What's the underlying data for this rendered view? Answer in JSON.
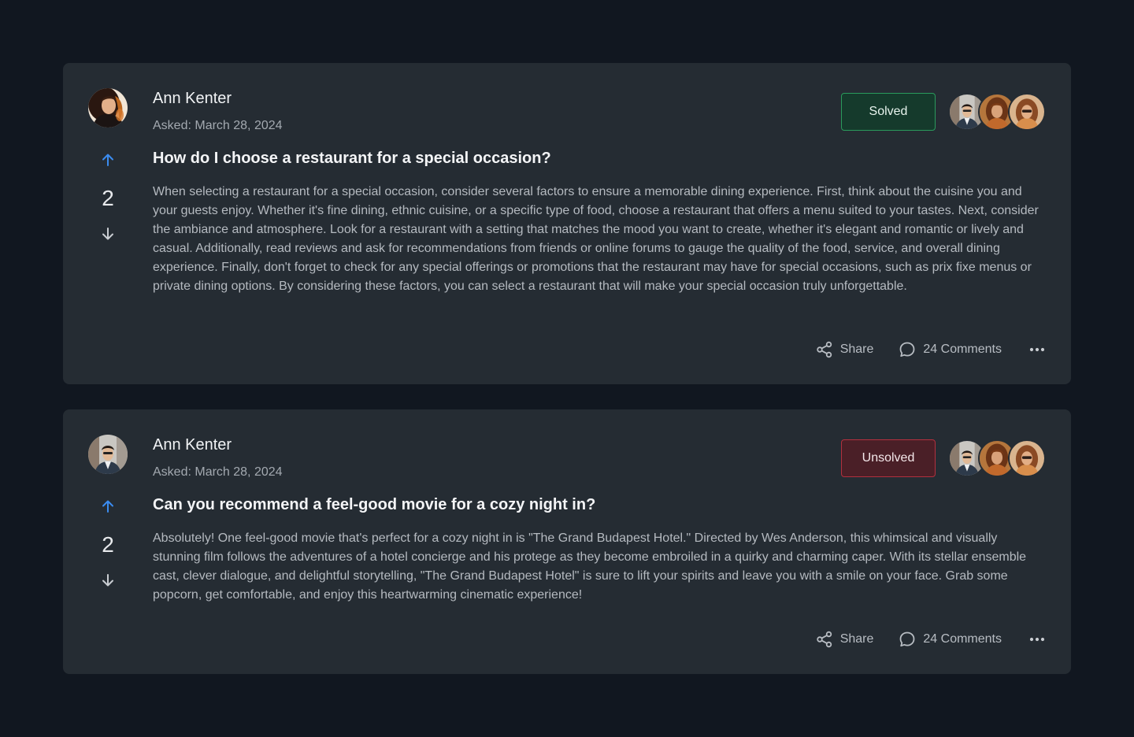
{
  "questions": [
    {
      "author": "Ann Kenter",
      "asked": "Asked: March 28, 2024",
      "votes": "2",
      "title": "How do I choose a restaurant for a special occasion?",
      "body": "When selecting a restaurant for a special occasion, consider several factors to ensure a memorable dining experience. First, think about the cuisine you and your guests enjoy. Whether it's fine dining, ethnic cuisine, or a specific type of food, choose a restaurant that offers a menu suited to your tastes. Next, consider the ambiance and atmosphere. Look for a restaurant with a setting that matches the mood you want to create, whether it's elegant and romantic or lively and casual. Additionally, read reviews and ask for recommendations from friends or online forums to gauge the quality of the food, service, and overall dining experience. Finally, don't forget to check for any special offerings or promotions that the restaurant may have for special occasions, such as prix fixe menus or private dining options. By considering these factors, you can select a restaurant that will make your special occasion truly unforgettable.",
      "status": "Solved",
      "share_label": "Share",
      "comments_label": "24 Comments",
      "avatar_icon": "woman-portrait-avatar"
    },
    {
      "author": "Ann Kenter",
      "asked": "Asked: March 28, 2024",
      "votes": "2",
      "title": "Can you recommend a feel-good movie for a cozy night in?",
      "body": "Absolutely! One feel-good movie that's perfect for a cozy night in is \"The Grand Budapest Hotel.\" Directed by Wes Anderson, this whimsical and visually stunning film follows the adventures of a hotel concierge and his protege as they become embroiled in a quirky and charming caper. With its stellar ensemble cast, clever dialogue, and delightful storytelling, \"The Grand Budapest Hotel\" is sure to lift your spirits and leave you with a smile on your face. Grab some popcorn, get comfortable, and enjoy this heartwarming cinematic experience!",
      "status": "Unsolved",
      "share_label": "Share",
      "comments_label": "24 Comments",
      "avatar_icon": "man-portrait-avatar"
    }
  ],
  "colors": {
    "background": "#111720",
    "card": "#252c33",
    "solved_border": "#2a9a5c",
    "unsolved_border": "#b3303e",
    "upvote_accent": "#3b8cf0"
  },
  "icons": {
    "upvote": "arrow-up-icon",
    "downvote": "arrow-down-icon",
    "share": "share-icon",
    "comments": "comment-bubble-icon",
    "more": "more-horizontal-icon"
  }
}
